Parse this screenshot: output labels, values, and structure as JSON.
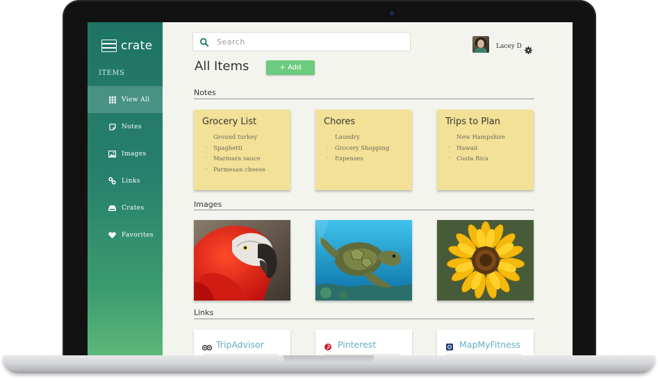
{
  "app": {
    "name": "crate"
  },
  "sidebar": {
    "section_label": "ITEMS",
    "items": [
      {
        "label": "View All",
        "icon": "grid-icon",
        "active": true
      },
      {
        "label": "Notes",
        "icon": "note-icon"
      },
      {
        "label": "Images",
        "icon": "image-icon"
      },
      {
        "label": "Links",
        "icon": "link-icon"
      },
      {
        "label": "Crates",
        "icon": "inbox-icon"
      },
      {
        "label": "Favorites",
        "icon": "heart-icon"
      }
    ]
  },
  "header": {
    "search_placeholder": "Search",
    "user_name": "Lacey D"
  },
  "main": {
    "title": "All Items",
    "add_label": "+ Add",
    "sections": {
      "notes": "Notes",
      "images": "Images",
      "links": "Links"
    },
    "notes": [
      {
        "title": "Grocery List",
        "items": [
          "Ground turkey",
          "Spaghetti",
          "Marinara sauce",
          "Parmesan cheese"
        ]
      },
      {
        "title": "Chores",
        "items": [
          "Laundry",
          "Grocery Shopping",
          "Expenses"
        ]
      },
      {
        "title": "Trips to Plan",
        "items": [
          "New Hampshire",
          "Hawaii",
          "Costa Rica"
        ]
      }
    ],
    "images": [
      {
        "subject": "parrot"
      },
      {
        "subject": "sea-turtle"
      },
      {
        "subject": "sunflower"
      }
    ],
    "links": [
      {
        "label": "TripAdvisor",
        "icon": "owl-icon"
      },
      {
        "label": "Pinterest",
        "icon": "pinterest-icon"
      },
      {
        "label": "MapMyFitness",
        "icon": "mapmyfitness-icon"
      }
    ]
  },
  "colors": {
    "sidebar_top": "#1e7464",
    "sidebar_bottom": "#5cb878",
    "add_button": "#6ccb7f",
    "note_bg": "#f2e196",
    "link_text": "#5fb0c6"
  }
}
